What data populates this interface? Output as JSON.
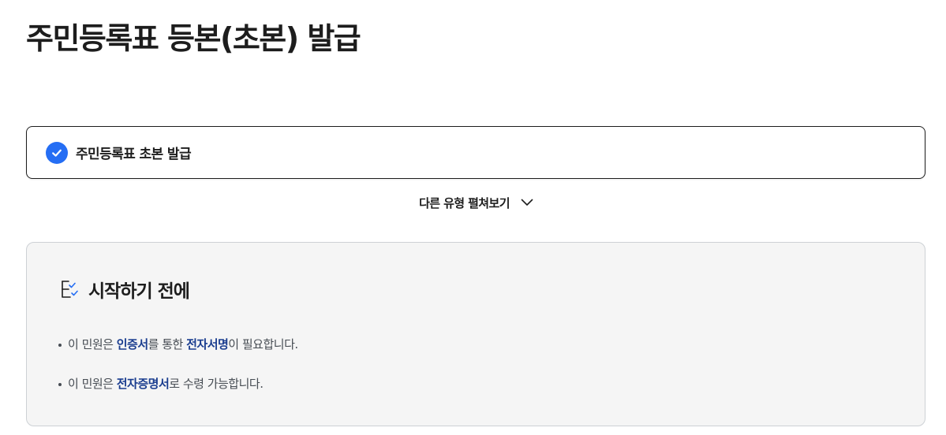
{
  "page": {
    "title": "주민등록표 등본(초본) 발급"
  },
  "selected_option": {
    "label": "주민등록표 초본 발급",
    "icon": "check-circle-icon",
    "accent_color": "#256ef4"
  },
  "expand": {
    "label": "다른 유형 펼쳐보기",
    "icon": "chevron-down-icon"
  },
  "notice": {
    "heading": "시작하기 전에",
    "heading_icon": "checklist-icon",
    "highlight_color": "#1a3d8f",
    "items": [
      {
        "parts": [
          "이 민원은 ",
          "인증서",
          "를 통한 ",
          "전자서명",
          "이 필요합니다."
        ]
      },
      {
        "parts": [
          "이 민원은 ",
          "전자증명서",
          "로 수령 가능합니다."
        ]
      }
    ]
  }
}
